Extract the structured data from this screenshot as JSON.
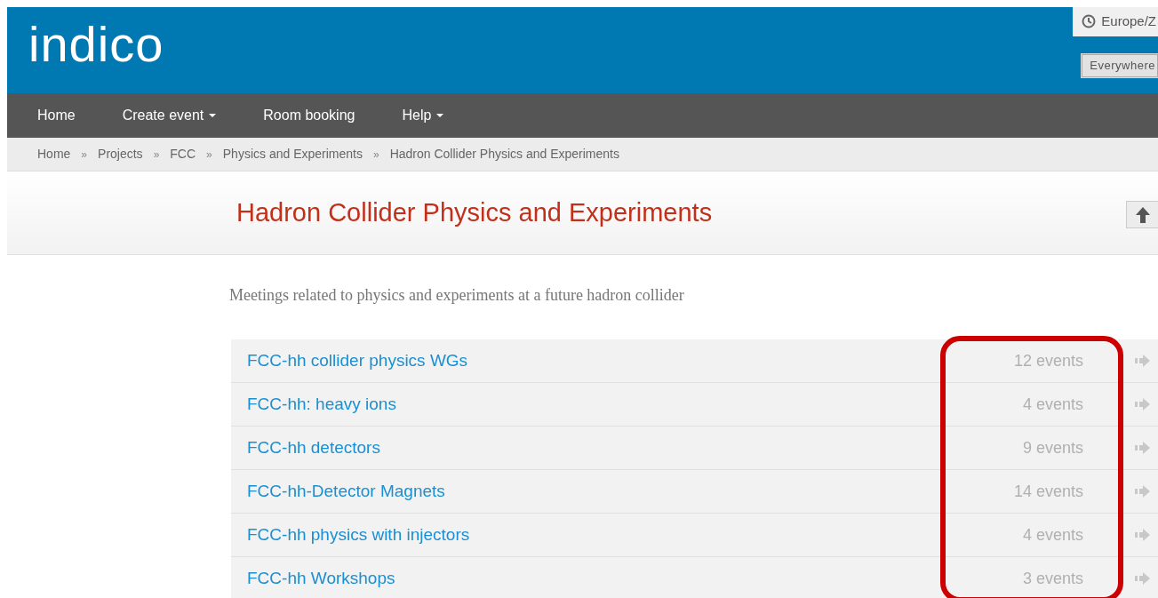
{
  "header": {
    "logo": "indico",
    "timezone": "Europe/Z",
    "search_scope": "Everywhere"
  },
  "nav": [
    {
      "label": "Home",
      "has_menu": false
    },
    {
      "label": "Create event",
      "has_menu": true
    },
    {
      "label": "Room booking",
      "has_menu": false
    },
    {
      "label": "Help",
      "has_menu": true
    }
  ],
  "breadcrumb": [
    {
      "kind": "link",
      "label": "Home"
    },
    {
      "kind": "separator",
      "label": "»"
    },
    {
      "kind": "link",
      "label": "Projects"
    },
    {
      "kind": "separator",
      "label": "»"
    },
    {
      "kind": "link",
      "label": "FCC"
    },
    {
      "kind": "separator",
      "label": "»"
    },
    {
      "kind": "link",
      "label": "Physics and Experiments"
    },
    {
      "kind": "separator",
      "label": "»"
    },
    {
      "kind": "current",
      "label": "Hadron Collider Physics and Experiments"
    }
  ],
  "category": {
    "title": "Hadron Collider Physics and Experiments",
    "description": "Meetings related to physics and experiments at a future hadron collider"
  },
  "subcategories": [
    {
      "name": "FCC-hh collider physics WGs",
      "count": "12 events"
    },
    {
      "name": "FCC-hh: heavy ions",
      "count": "4 events"
    },
    {
      "name": "FCC-hh detectors",
      "count": "9 events"
    },
    {
      "name": "FCC-hh-Detector Magnets",
      "count": "14 events"
    },
    {
      "name": "FCC-hh physics with injectors",
      "count": "4 events"
    },
    {
      "name": "FCC-hh Workshops",
      "count": "3 events"
    }
  ],
  "annotation": {
    "kind": "outline",
    "color": "#cc0000"
  }
}
